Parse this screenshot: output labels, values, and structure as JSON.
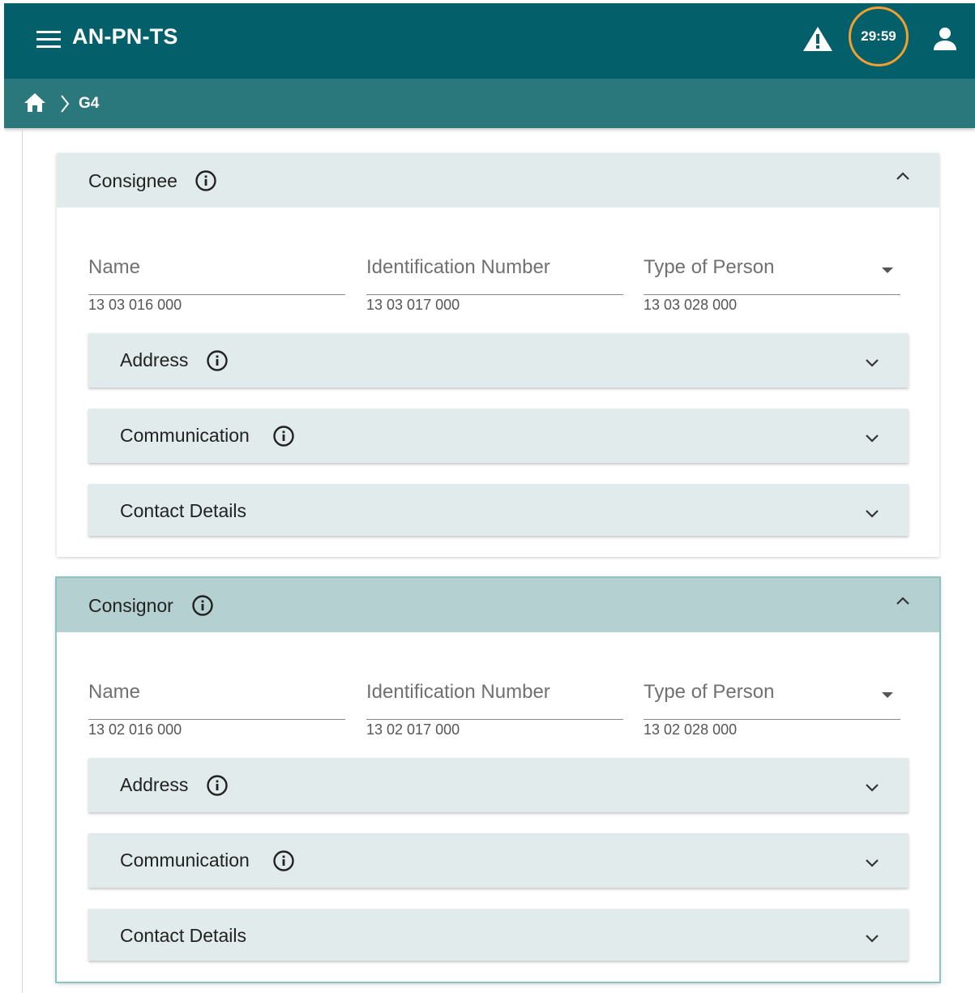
{
  "app": {
    "title": "AN-PN-TS",
    "timer": "29:59"
  },
  "breadcrumb": {
    "current": "G4"
  },
  "icons": {
    "menu": "menu-icon",
    "warning": "warning-icon",
    "user": "user-icon",
    "home": "home-icon",
    "info": "info-icon",
    "expand": "chevron-down-icon",
    "collapse": "chevron-up-icon"
  },
  "colors": {
    "topbar": "#03606a",
    "breadcrumb_bar": "#2a787c",
    "timer_ring": "#f0a030",
    "panel_header": "#e1ebeb",
    "panel_header_active": "#b5d0d1"
  },
  "consignee": {
    "title": "Consignee",
    "fields": {
      "name_label": "Name",
      "name_code": "13 03 016 000",
      "id_label": "Identification Number",
      "id_code": "13 03 017 000",
      "type_label": "Type of Person",
      "type_code": "13 03 028 000"
    },
    "sections": {
      "address": "Address",
      "communication": "Communication",
      "contact": "Contact Details"
    }
  },
  "consignor": {
    "title": "Consignor",
    "fields": {
      "name_label": "Name",
      "name_code": "13 02 016 000",
      "id_label": "Identification Number",
      "id_code": "13 02 017 000",
      "type_label": "Type of Person",
      "type_code": "13 02 028 000"
    },
    "sections": {
      "address": "Address",
      "communication": "Communication",
      "contact": "Contact Details"
    }
  }
}
